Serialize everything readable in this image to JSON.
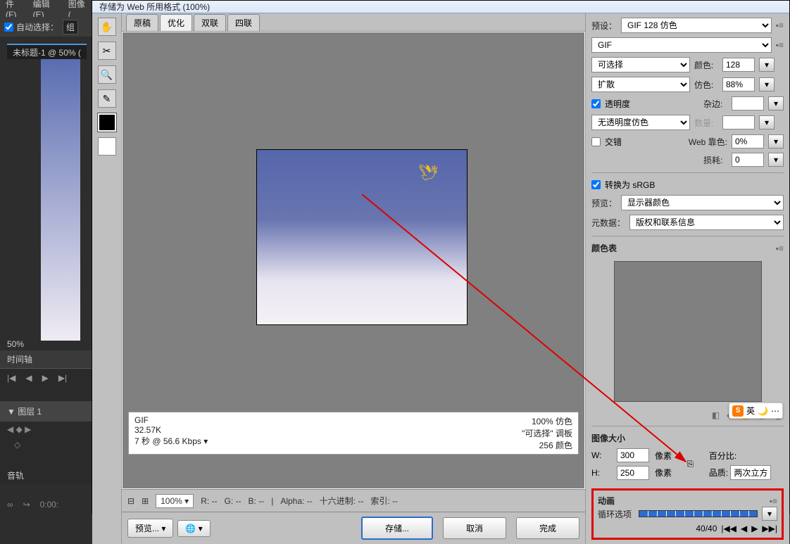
{
  "ps_bg": {
    "menu": {
      "file": "件(F)",
      "edit": "编辑(E)",
      "image": "图像("
    },
    "autoselect": "自动选择：",
    "autoselect_val": "组",
    "doc_tab": "未标题-1 @ 50% (",
    "zoom": "50%",
    "timeline": "时间轴",
    "layer": "图层 1",
    "audio": "音轨",
    "counter": "0:00:"
  },
  "dialog": {
    "title": "存储为 Web 所用格式 (100%)",
    "tabs": {
      "t1": "原稿",
      "t2": "优化",
      "t3": "双联",
      "t4": "四联"
    },
    "info": {
      "fmt": "GIF",
      "size": "32.57K",
      "speed": "7 秒 @ 56.6 Kbps",
      "pct": "100% 仿色",
      "pal": "\"可选择\" 调板",
      "colors": "256 颜色"
    },
    "zoom": {
      "val": "100%",
      "r": "R: --",
      "g": "G: --",
      "b": "B: --",
      "alpha": "Alpha: --",
      "hex": "十六进制: --",
      "idx": "索引: --"
    },
    "bottom": {
      "preview": "预览...",
      "save": "存储...",
      "cancel": "取消",
      "done": "完成"
    }
  },
  "opt": {
    "preset_lbl": "预设：",
    "preset_val": "GIF 128 仿色",
    "format_val": "GIF",
    "reduction_val": "可选择",
    "colors_lbl": "颜色:",
    "colors_val": "128",
    "dither_val": "扩散",
    "dither_lbl": "仿色:",
    "dither_pct": "88%",
    "transp_lbl": "透明度",
    "matte_lbl": "杂边:",
    "matte_val": "",
    "trdith_val": "无透明度仿色",
    "amount_lbl": "数量:",
    "amount_val": "",
    "interlace_lbl": "交错",
    "web_lbl": "Web 靠色:",
    "web_val": "0%",
    "lossy_lbl": "损耗:",
    "lossy_val": "0",
    "srgb_lbl": "转换为 sRGB",
    "preview_lbl": "预览：",
    "preview_val": "显示器颜色",
    "meta_lbl": "元数据：",
    "meta_val": "版权和联系信息",
    "ct_title": "颜色表",
    "size_title": "图像大小",
    "w_lbl": "W:",
    "w_val": "300",
    "h_lbl": "H:",
    "h_val": "250",
    "px": "像素",
    "pct_lbl": "百分比:",
    "qual_lbl": "品质:",
    "qual_val": "两次立方",
    "anim_title": "动画",
    "loop_lbl": "循环选项",
    "frame": "40/40"
  },
  "ime": "英"
}
